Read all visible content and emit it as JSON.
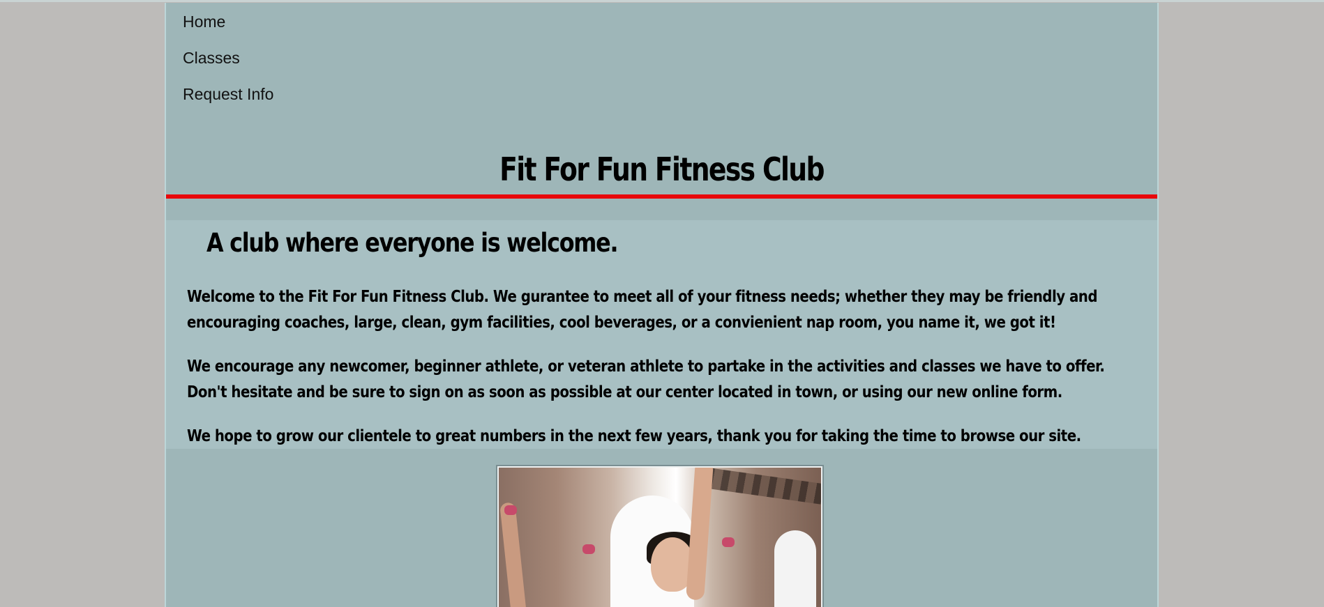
{
  "nav": {
    "items": [
      {
        "label": "Home"
      },
      {
        "label": "Classes"
      },
      {
        "label": "Request Info"
      }
    ]
  },
  "header": {
    "title": "Fit For Fun Fitness Club"
  },
  "intro": {
    "heading": "A club where everyone is welcome.",
    "paragraph_1": "Welcome to the Fit For Fun Fitness Club. We gurantee to meet all of your fitness needs; whether they may be friendly and encouraging coaches, large, clean, gym facilities, cool beverages, or a convienient nap room, you name it, we got it!",
    "paragraph_2_text": "We encourage any newcomer, beginner athlete, or veteran athlete to partake in the activities and classes we have to offer. Don't hesitate and be sure to sign on as soon as possible at our center located in town, or using our new ",
    "paragraph_2_link": "online form.",
    "paragraph_3": "We hope to grow our clientele to great numbers in the next few years, thank you for taking the time to browse our site."
  },
  "colors": {
    "page_background": "#bdbbb9",
    "container_background": "#9eb6b8",
    "intro_background": "#a8c0c3",
    "accent_rule": "#e8070b"
  }
}
